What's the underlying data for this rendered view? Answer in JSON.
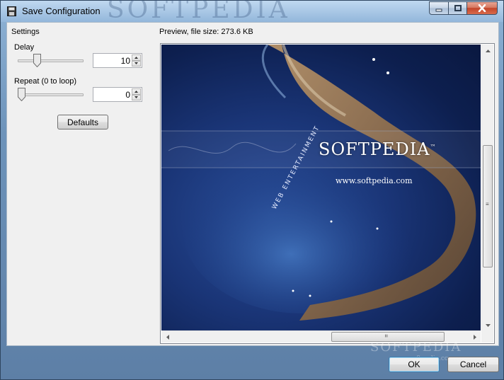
{
  "window": {
    "title": "Save Configuration",
    "titlebar_watermark": "SOFTPEDIA"
  },
  "settings": {
    "group_label": "Settings",
    "delay_label": "Delay",
    "delay_value": "10",
    "delay_slider_fraction": 0.28,
    "repeat_label": "Repeat (0 to loop)",
    "repeat_value": "0",
    "repeat_slider_fraction": 0.0,
    "defaults_label": "Defaults"
  },
  "preview": {
    "label": "Preview, file size: 273.6 KB",
    "logo_text": "SOFTPEDIA",
    "logo_mark": "™",
    "url_text": "www.softpedia.com",
    "arc_text": "WEB ENTERTAINMENT"
  },
  "footer": {
    "ok_label": "OK",
    "cancel_label": "Cancel",
    "watermark": "SOFTPEDIA",
    "watermark_url": "www.softpedia.com"
  },
  "colors": {
    "window_frame": "#6d93ba",
    "client_bg": "#f0f0f0",
    "sea_blue": "#1a3577",
    "rock_brown": "#8a6a4a",
    "close_red": "#c3452a"
  }
}
